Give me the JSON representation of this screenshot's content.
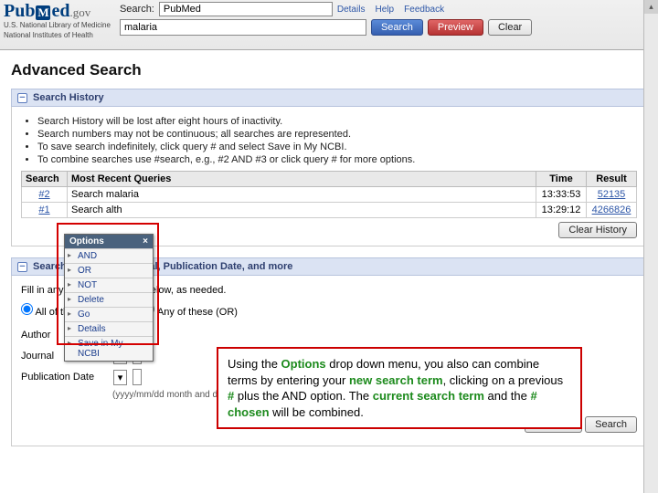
{
  "header": {
    "logo_pub": "Pub",
    "logo_m": "M",
    "logo_ed": "ed",
    "logo_gov": ".gov",
    "sub1": "U.S. National Library of Medicine",
    "sub2": "National Institutes of Health",
    "search_label": "Search:",
    "search_scope": "PubMed",
    "links": {
      "details": "Details",
      "help": "Help",
      "feedback": "Feedback"
    },
    "search_value": "malaria",
    "btn_search": "Search",
    "btn_preview": "Preview",
    "btn_clear": "Clear"
  },
  "page_title": "Advanced Search",
  "history": {
    "title": "Search History",
    "notes": [
      "Search History will be lost after eight hours of inactivity.",
      "Search numbers may not be continuous; all searches are represented.",
      "To save search indefinitely, click query # and select Save in My NCBI.",
      "To combine searches use #search, e.g., #2 AND #3 or click query # for more options."
    ],
    "cols": {
      "search": "Search",
      "query": "Most Recent Queries",
      "time": "Time",
      "result": "Result"
    },
    "rows": [
      {
        "num": "#2",
        "query": "Search malaria",
        "time": "13:33:53",
        "result": "52135"
      },
      {
        "num": "#1",
        "query": "Search alth",
        "time": "13:29:12",
        "result": "4266826"
      }
    ],
    "clear_btn": "Clear History"
  },
  "builder": {
    "title": "Search by Author, Journal, Publication Date, and more",
    "instr": "Fill in any or all of the fields below, as needed.",
    "radio_all": "All of these (AND)",
    "radio_any": "Any of these (OR)",
    "author_label": "Author",
    "journal_label": "Journal",
    "pubdate_label": "Publication Date",
    "date_hint": "(yyyy/mm/dd   month and day are optional)",
    "btn_clear_all": "Clear All",
    "btn_search": "Search"
  },
  "options_menu": {
    "title": "Options",
    "items": [
      "AND",
      "OR",
      "NOT",
      "Delete",
      "Go",
      "Details",
      "Save in My NCBI"
    ]
  },
  "callout": {
    "p1a": "Using the ",
    "opt": "Options",
    "p1b": " drop down menu, you also can combine terms by entering your ",
    "new": "new search term",
    "p1c": ", clicking on a previous ",
    "hash1": "#",
    "p1d": " plus the AND option.   The ",
    "cur": "current search term",
    "p1e": " and the ",
    "hash2": "# chosen",
    "p1f": " will be combined."
  }
}
